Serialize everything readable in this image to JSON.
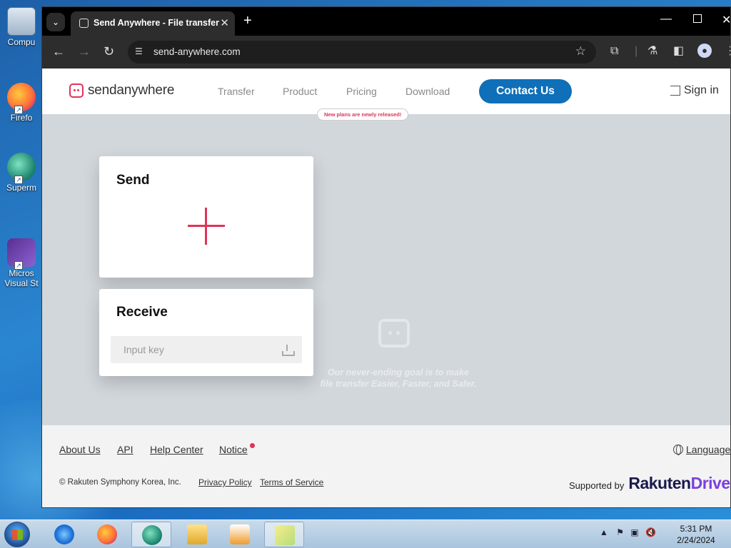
{
  "desktop": {
    "icons": [
      {
        "label": "Compu"
      },
      {
        "label": "Firefo"
      },
      {
        "label": "Superm"
      },
      {
        "label": "Micros",
        "label2": "Visual St"
      }
    ]
  },
  "browser": {
    "tab_title": "Send Anywhere - File transfer",
    "url": "send-anywhere.com"
  },
  "header": {
    "logo_send": "send",
    "logo_anywhere": "anywhere",
    "nav": [
      "Transfer",
      "Product",
      "Pricing",
      "Download"
    ],
    "pricing_badge": "New plans are newly released!",
    "contact_label": "Contact Us",
    "signin_label": "Sign in"
  },
  "send_card": {
    "title": "Send"
  },
  "receive_card": {
    "title": "Receive",
    "input_placeholder": "Input key"
  },
  "tagline": {
    "line1": "Our never-ending goal is to make",
    "line2": "file transfer Easier, Faster, and Safer."
  },
  "footer": {
    "links": [
      "About Us",
      "API",
      "Help Center",
      "Notice"
    ],
    "language_label": "Language",
    "copyright": "© Rakuten Symphony Korea, Inc.",
    "privacy": "Privacy Policy",
    "terms": "Terms of Service",
    "supported_by": "Supported by",
    "rakuten_a": "Rakuten",
    "rakuten_b": "Drive"
  },
  "taskbar": {
    "time": "5:31 PM",
    "date": "2/24/2024"
  },
  "colors": {
    "brand": "#e0335a",
    "contact_button": "#0f6fb8",
    "page_bg": "#d2d7dc"
  }
}
